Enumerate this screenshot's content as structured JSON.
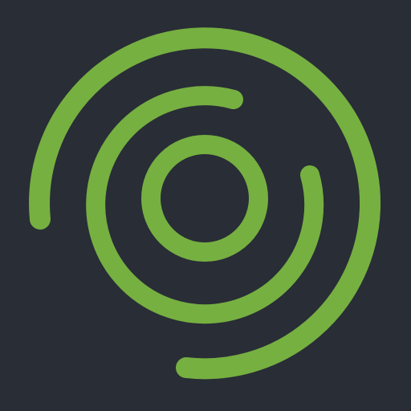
{
  "app_icon": {
    "name": "concentric-rings-logo",
    "colors": {
      "background": "#292d36",
      "accent": "#76b041"
    }
  }
}
